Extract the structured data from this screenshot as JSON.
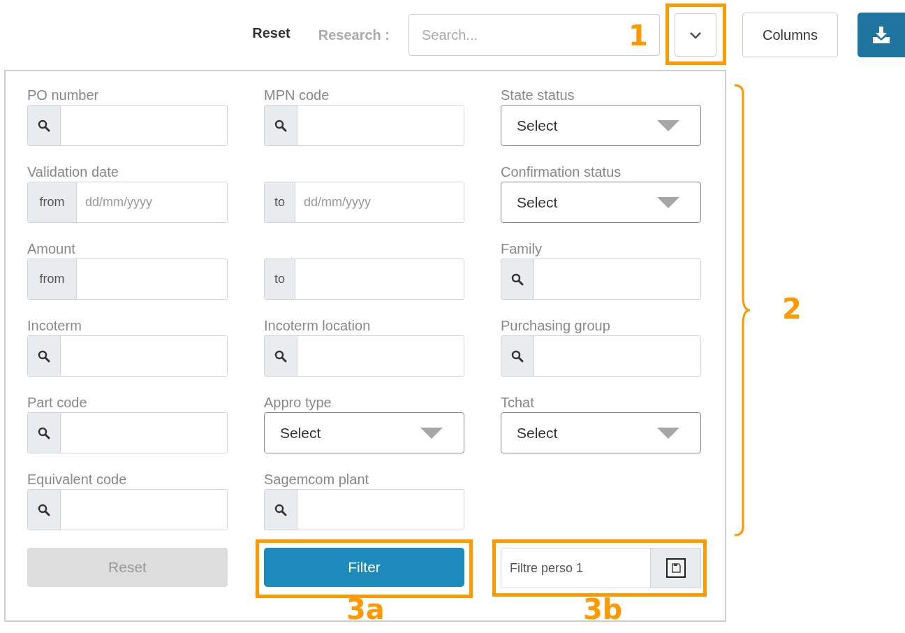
{
  "toolbar": {
    "reset": "Reset",
    "research_label": "Research :",
    "search": {
      "placeholder": "Search..."
    },
    "toggle": {
      "annotation": "1"
    },
    "columns_button": "Columns"
  },
  "filter_panel": {
    "annotation": "2",
    "fields": [
      {
        "kind": "search",
        "label": "PO number"
      },
      {
        "kind": "search",
        "label": "MPN code"
      },
      {
        "kind": "select",
        "label": "State status",
        "value": "Select"
      },
      {
        "kind": "range",
        "label": "Validation date",
        "prefix": "from",
        "placeholder": "dd/mm/yyyy"
      },
      {
        "kind": "range",
        "prefix": "to",
        "placeholder": "dd/mm/yyyy"
      },
      {
        "kind": "select",
        "label": "Confirmation status",
        "value": "Select"
      },
      {
        "kind": "range",
        "label": "Amount",
        "prefix": "from"
      },
      {
        "kind": "range",
        "prefix": "to"
      },
      {
        "kind": "search",
        "label": "Family"
      },
      {
        "kind": "search",
        "label": "Incoterm"
      },
      {
        "kind": "search",
        "label": "Incoterm location"
      },
      {
        "kind": "search",
        "label": "Purchasing group"
      },
      {
        "kind": "search",
        "label": "Part code"
      },
      {
        "kind": "select",
        "label": "Appro type",
        "value": "Select"
      },
      {
        "kind": "select",
        "label": "Tchat",
        "value": "Select"
      },
      {
        "kind": "search",
        "label": "Equivalent code"
      },
      {
        "kind": "search",
        "label": "Sagemcom plant"
      },
      {
        "kind": "empty"
      }
    ],
    "reset_button": {
      "label": "Reset",
      "disabled": true
    },
    "filter_button": {
      "label": "Filter",
      "annotation": "3a"
    },
    "saved_filter": {
      "value": "Filtre perso 1",
      "annotation": "3b"
    }
  }
}
